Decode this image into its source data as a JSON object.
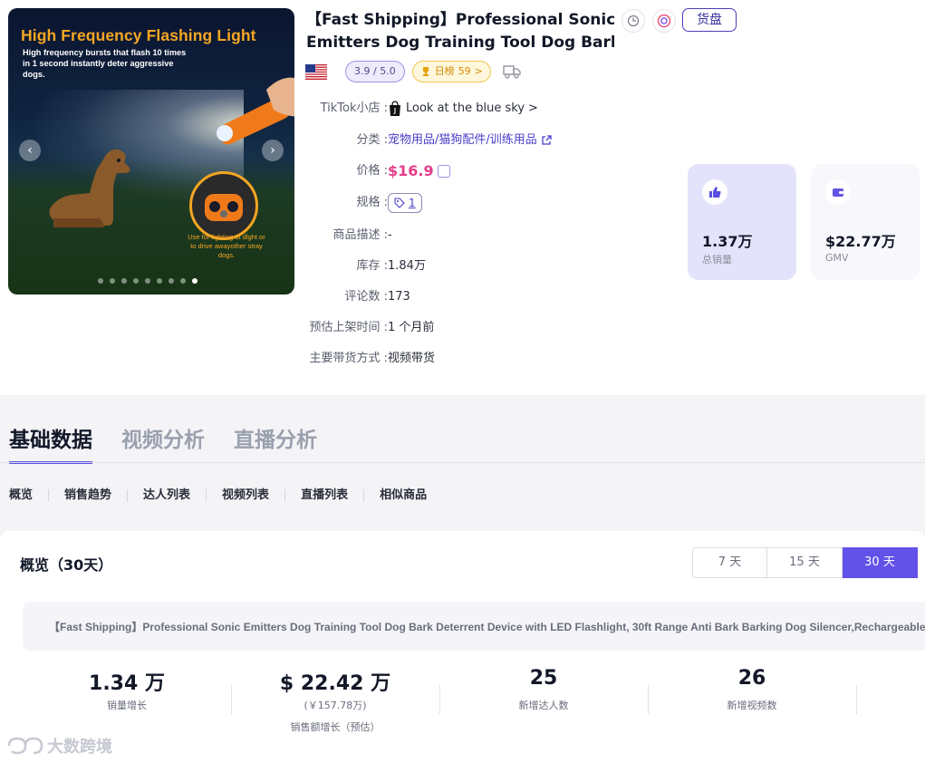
{
  "hero": {
    "headline": "High Frequency Flashing Light",
    "subtext": "High frequency bursts that flash 10 times in 1 second instantly deter aggressive dogs.",
    "circle_caption": "Use for lighting at dlght or to drive awayother stray dogs.",
    "prev": "‹",
    "next": "›",
    "dot_count": 9,
    "active_dot": 9
  },
  "product": {
    "title_line1": "【Fast Shipping】Professional Sonic",
    "title_line2": "Emitters Dog Training Tool Dog Bark...",
    "huopan_label": "货盘",
    "rating": "3.9 / 5.0",
    "rank_label": "日榜",
    "rank_value": "59",
    "rank_arrow": ">"
  },
  "details": {
    "shop_key": "TikTok小店 :",
    "shop_value": "Look at the blue sky",
    "shop_arrow": ">",
    "category_key": "分类 :",
    "category_value": "宠物用品/猫狗配件/训练用品",
    "price_key": "价格 :",
    "price_value": "$16.9",
    "spec_key": "规格 :",
    "spec_value": "1",
    "desc_key": "商品描述 :",
    "desc_value": "-",
    "stock_key": "库存 :",
    "stock_value": "1.84万",
    "reviews_key": "评论数 :",
    "reviews_value": "173",
    "listed_key": "预估上架时间 :",
    "listed_value": "1 个月前",
    "channel_key": "主要带货方式 :",
    "channel_value": "视频带货"
  },
  "stat_cards": {
    "sales_value": "1.37万",
    "sales_label": "总销量",
    "gmv_value": "$22.77万",
    "gmv_label": "GMV"
  },
  "tabs": [
    "基础数据",
    "视频分析",
    "直播分析"
  ],
  "subnav": [
    "概览",
    "销售趋势",
    "达人列表",
    "视频列表",
    "直播列表",
    "相似商品"
  ],
  "overview": {
    "title": "概览（30天）",
    "ranges": [
      "7 天",
      "15 天",
      "30 天"
    ],
    "active_range": "30 天",
    "full_title": "【Fast Shipping】Professional Sonic Emitters Dog Training Tool Dog Bark Deterrent Device with LED Flashlight, 30ft Range Anti Bark Barking Dog Silencer,Rechargeable Portable dog ba",
    "metrics": [
      {
        "value": "1.34 万",
        "label": "销量增长"
      },
      {
        "value": "$ 22.42 万",
        "sub": "(￥157.78万)",
        "label": "销售额增长（预估）"
      },
      {
        "value": "25",
        "label": "新增达人数"
      },
      {
        "value": "26",
        "label": "新增视频数"
      }
    ]
  },
  "watermark": "大数跨境",
  "colors": {
    "accent": "#6352e8",
    "price": "#e43d8a",
    "link": "#4a3fc8",
    "hero_headline": "#f5a623"
  }
}
